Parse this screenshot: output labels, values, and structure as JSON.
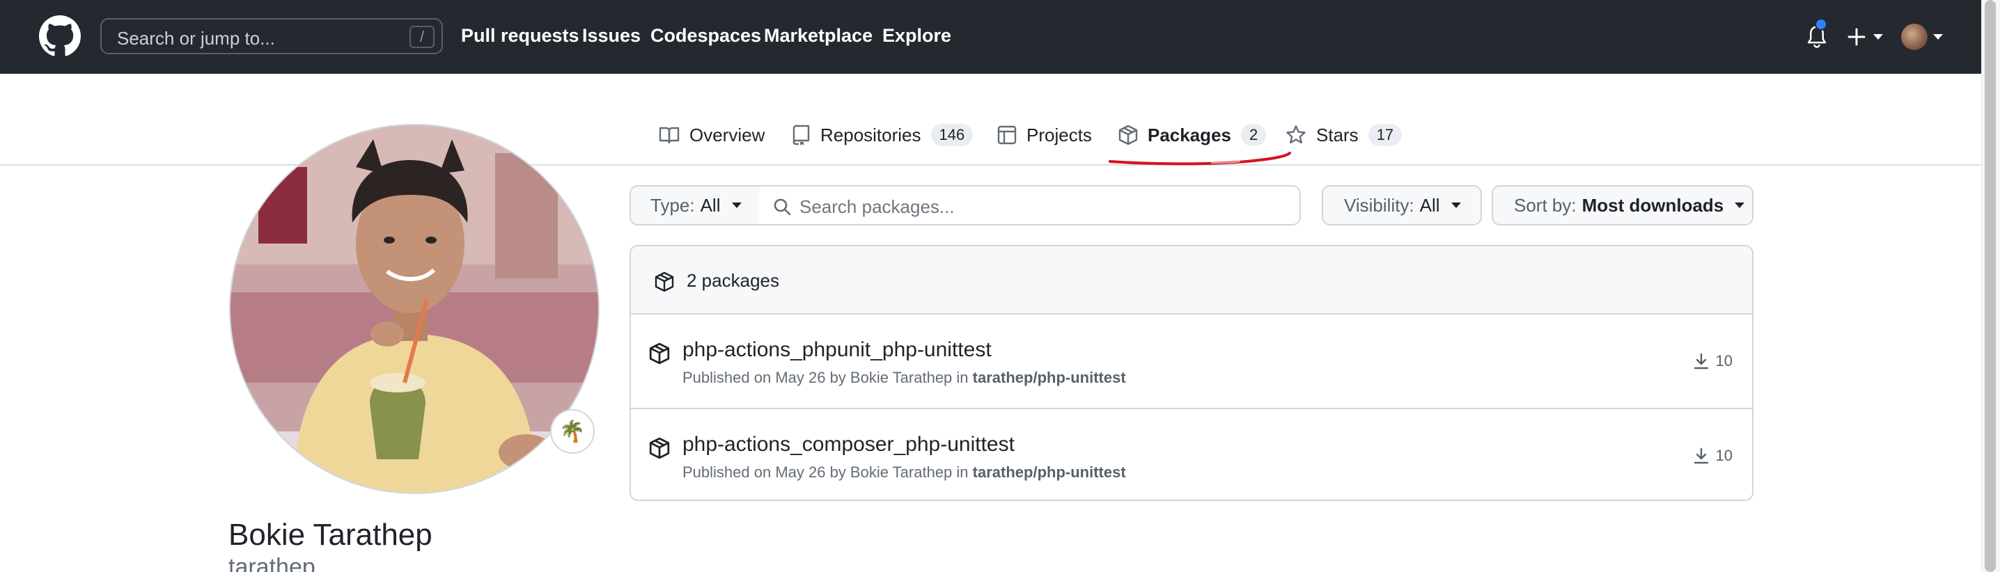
{
  "header": {
    "search_placeholder": "Search or jump to...",
    "search_shortcut": "/",
    "nav": [
      "Pull requests",
      "Issues",
      "Codespaces",
      "Marketplace",
      "Explore"
    ],
    "icons": [
      "github-logo-icon",
      "bell-icon",
      "plus-icon",
      "avatar"
    ],
    "notification_dot_color": "#2f81f7"
  },
  "tabs": [
    {
      "label": "Overview",
      "icon": "book-icon"
    },
    {
      "label": "Repositories",
      "icon": "repo-icon",
      "count": "146"
    },
    {
      "label": "Projects",
      "icon": "table-icon"
    },
    {
      "label": "Packages",
      "icon": "package-icon",
      "count": "2",
      "selected": true
    },
    {
      "label": "Stars",
      "icon": "star-icon",
      "count": "17"
    }
  ],
  "profile": {
    "name": "Bokie Tarathep",
    "login": "tarathep",
    "status_emoji": "🌴"
  },
  "filters": {
    "type_key": "Type:",
    "type_value": "All",
    "search_placeholder": "Search packages...",
    "visibility_key": "Visibility:",
    "visibility_value": "All",
    "sort_key": "Sort by:",
    "sort_value": "Most downloads"
  },
  "packages": {
    "count_label": "2 packages",
    "items": [
      {
        "name": "php-actions_phpunit_php-unittest",
        "meta_prefix": "Published on May 26 by Bokie Tarathep in",
        "repo": "tarathep/php-unittest",
        "downloads": "10"
      },
      {
        "name": "php-actions_composer_php-unittest",
        "meta_prefix": "Published on May 26 by Bokie Tarathep in",
        "repo": "tarathep/php-unittest",
        "downloads": "10"
      }
    ]
  },
  "colors": {
    "header_bg": "#24292f",
    "annotation_red": "#d4141f",
    "border": "#d0d7de"
  }
}
